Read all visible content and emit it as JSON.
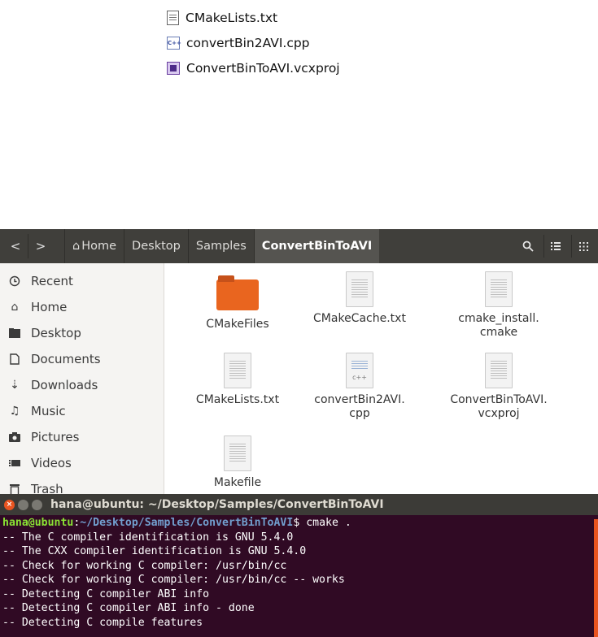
{
  "win_listing": [
    {
      "name": "CMakeLists.txt",
      "icon": "text-file-icon"
    },
    {
      "name": "convertBin2AVI.cpp",
      "icon": "cpp-file-icon"
    },
    {
      "name": "ConvertBinToAVI.vcxproj",
      "icon": "vcxproj-file-icon"
    }
  ],
  "nautilus": {
    "breadcrumbs": [
      "Home",
      "Desktop",
      "Samples",
      "ConvertBinToAVI"
    ],
    "nav": {
      "back": "<",
      "forward": ">"
    },
    "sidebar": [
      {
        "label": "Recent",
        "icon": "clock-icon"
      },
      {
        "label": "Home",
        "icon": "home-icon"
      },
      {
        "label": "Desktop",
        "icon": "desktop-icon"
      },
      {
        "label": "Documents",
        "icon": "document-icon"
      },
      {
        "label": "Downloads",
        "icon": "download-icon"
      },
      {
        "label": "Music",
        "icon": "music-icon"
      },
      {
        "label": "Pictures",
        "icon": "camera-icon"
      },
      {
        "label": "Videos",
        "icon": "video-icon"
      },
      {
        "label": "Trash",
        "icon": "trash-icon"
      }
    ],
    "files": [
      {
        "line1": "CMakeFiles",
        "line2": "",
        "type": "folder"
      },
      {
        "line1": "CMakeCache.txt",
        "line2": "",
        "type": "text"
      },
      {
        "line1": "cmake_install.",
        "line2": "cmake",
        "type": "text"
      },
      {
        "line1": "CMakeLists.txt",
        "line2": "",
        "type": "text"
      },
      {
        "line1": "convertBin2AVI.",
        "line2": "cpp",
        "type": "cpp"
      },
      {
        "line1": "ConvertBinToAVI.",
        "line2": "vcxproj",
        "type": "text"
      },
      {
        "line1": "Makefile",
        "line2": "",
        "type": "text"
      }
    ],
    "cpp_badge": "c++"
  },
  "terminal": {
    "title": "hana@ubuntu: ~/Desktop/Samples/ConvertBinToAVI",
    "prompt_user": "hana@ubuntu",
    "prompt_sep": ":",
    "prompt_path": "~/Desktop/Samples/ConvertBinToAVI",
    "prompt_end": "$ cmake .",
    "lines": [
      "-- The C compiler identification is GNU 5.4.0",
      "-- The CXX compiler identification is GNU 5.4.0",
      "-- Check for working C compiler: /usr/bin/cc",
      "-- Check for working C compiler: /usr/bin/cc -- works",
      "-- Detecting C compiler ABI info",
      "-- Detecting C compiler ABI info - done",
      "-- Detecting C compile features"
    ]
  },
  "colors": {
    "terminal_bg": "#300a24",
    "accent": "#e95420",
    "headerbar": "#403f3b"
  }
}
